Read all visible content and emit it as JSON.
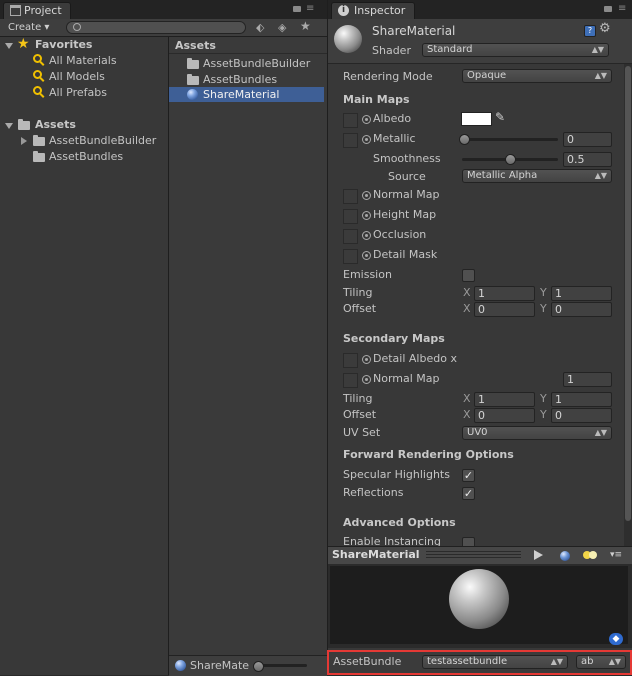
{
  "project": {
    "tab_label": "Project",
    "create_label": "Create ▾",
    "search_placeholder": "",
    "tree": {
      "favorites_label": "Favorites",
      "favorites_items": [
        "All Materials",
        "All Models",
        "All Prefabs"
      ],
      "assets_label": "Assets",
      "assets_items": [
        "AssetBundleBuilder",
        "AssetBundles"
      ]
    },
    "list": {
      "header": "Assets",
      "items": [
        "AssetBundleBuilder",
        "AssetBundles",
        "ShareMaterial"
      ]
    },
    "footer_label": "ShareMate"
  },
  "inspector": {
    "tab_label": "Inspector",
    "material_name": "ShareMaterial",
    "shader_label": "Shader",
    "shader_value": "Standard",
    "rendering_mode_label": "Rendering Mode",
    "rendering_mode_value": "Opaque",
    "main_maps": {
      "header": "Main Maps",
      "albedo": "Albedo",
      "metallic": "Metallic",
      "metallic_value": "0",
      "metallic_level": 0,
      "smoothness": "Smoothness",
      "smoothness_value": "0.5",
      "smoothness_level": 0.5,
      "source": "Source",
      "source_value": "Metallic Alpha",
      "normal_map": "Normal Map",
      "height_map": "Height Map",
      "occlusion": "Occlusion",
      "detail_mask": "Detail Mask",
      "emission": "Emission",
      "tiling": "Tiling",
      "offset": "Offset",
      "tiling_x": "1",
      "tiling_y": "1",
      "offset_x": "0",
      "offset_y": "0",
      "x": "X",
      "y": "Y"
    },
    "secondary_maps": {
      "header": "Secondary Maps",
      "detail_albedo": "Detail Albedo x",
      "normal_map": "Normal Map",
      "normal_value": "1",
      "tiling": "Tiling",
      "offset": "Offset",
      "tiling_x": "1",
      "tiling_y": "1",
      "offset_x": "0",
      "offset_y": "0",
      "uv_set": "UV Set",
      "uv_set_value": "UV0"
    },
    "forward_rendering": {
      "header": "Forward Rendering Options",
      "specular": "Specular Highlights",
      "reflections": "Reflections"
    },
    "advanced": {
      "header": "Advanced Options",
      "instancing": "Enable Instancing"
    },
    "preview": {
      "title": "ShareMaterial"
    },
    "assetbundle": {
      "label": "AssetBundle",
      "name_value": "testassetbundle",
      "variant_value": "ab"
    }
  },
  "colors": {
    "highlight": "#e53935",
    "selection": "#3e5f96",
    "favorite_star": "#f5c518"
  },
  "icons": [
    "star-icon",
    "search-icon",
    "folder-icon",
    "material-sphere-icon",
    "lock-icon",
    "menu-icon",
    "gear-icon",
    "help-icon",
    "info-icon",
    "eyedropper-icon",
    "play-icon",
    "tag-icon"
  ]
}
